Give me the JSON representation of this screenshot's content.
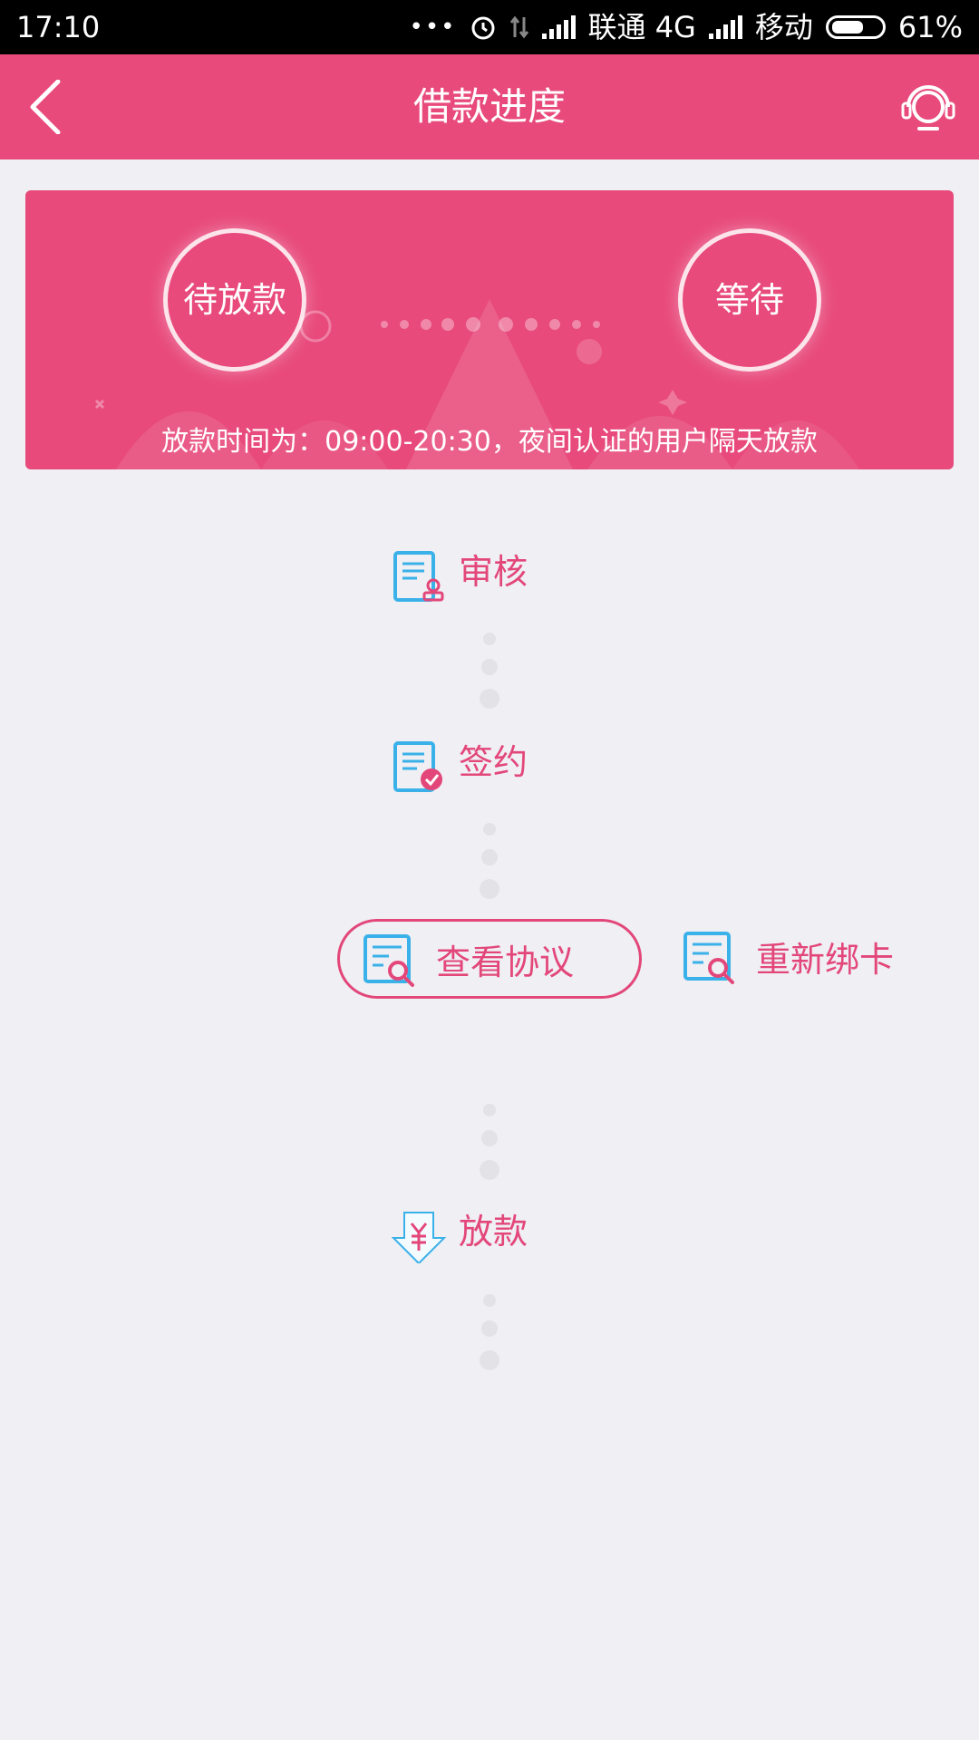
{
  "status_bar": {
    "time": "17:10",
    "more": "•••",
    "carrier1": "联通 4G",
    "carrier2": "移动",
    "battery": "61%"
  },
  "header": {
    "title": "借款进度",
    "back_icon": "chevron-left-icon",
    "service_icon": "headset-icon"
  },
  "banner": {
    "left_status": "待放款",
    "right_status": "等待",
    "note": "放款时间为：09:00-20:30，夜间认证的用户隔天放款"
  },
  "steps": {
    "review": {
      "label": "审核",
      "icon": "document-stamp-icon"
    },
    "sign": {
      "label": "签约",
      "icon": "document-check-icon"
    },
    "disburse": {
      "label": "放款",
      "icon": "yuan-arrow-icon"
    }
  },
  "actions": {
    "view_agreement": {
      "label": "查看协议",
      "icon": "document-search-icon"
    },
    "rebind_card": {
      "label": "重新绑卡",
      "icon": "document-search-icon"
    }
  },
  "colors": {
    "primary": "#e84a7b",
    "accent_text": "#e3477a",
    "icon_blue": "#3ab1e8",
    "background": "#efeff4"
  }
}
